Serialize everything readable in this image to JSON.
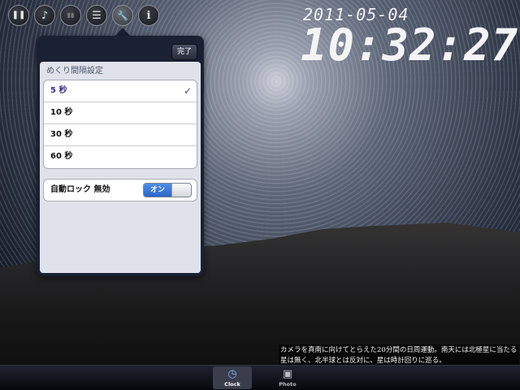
{
  "toolbar": {
    "buttons": [
      {
        "icon": "pause-icon",
        "glyph": "❚❚"
      },
      {
        "icon": "music-note-icon",
        "glyph": "♪"
      },
      {
        "icon": "equalizer-icon",
        "glyph": "▮▮"
      },
      {
        "icon": "list-icon",
        "glyph": "☰"
      },
      {
        "icon": "wrench-icon",
        "glyph": "🔧"
      },
      {
        "icon": "info-icon",
        "glyph": "i"
      }
    ]
  },
  "clock": {
    "date": "2011-05-04",
    "time": "10:32:27"
  },
  "settings": {
    "done_label": "完了",
    "interval_title": "めくり間隔設定",
    "intervals": [
      "5 秒",
      "10 秒",
      "30 秒",
      "60 秒"
    ],
    "selected_index": 0,
    "check": "✓",
    "autolock_label": "自動ロック 無効",
    "autolock_toggle": "オン"
  },
  "caption": "カメラを真南に向けてとらえた20分間の日周運動。南天には北極星に当たる星は無く、北半球とは反対に、星は時計回りに巡る。",
  "tabs": [
    {
      "label": "Clock",
      "icon": "clock-icon",
      "active": true
    },
    {
      "label": "Photo",
      "icon": "photo-icon",
      "active": false
    }
  ]
}
